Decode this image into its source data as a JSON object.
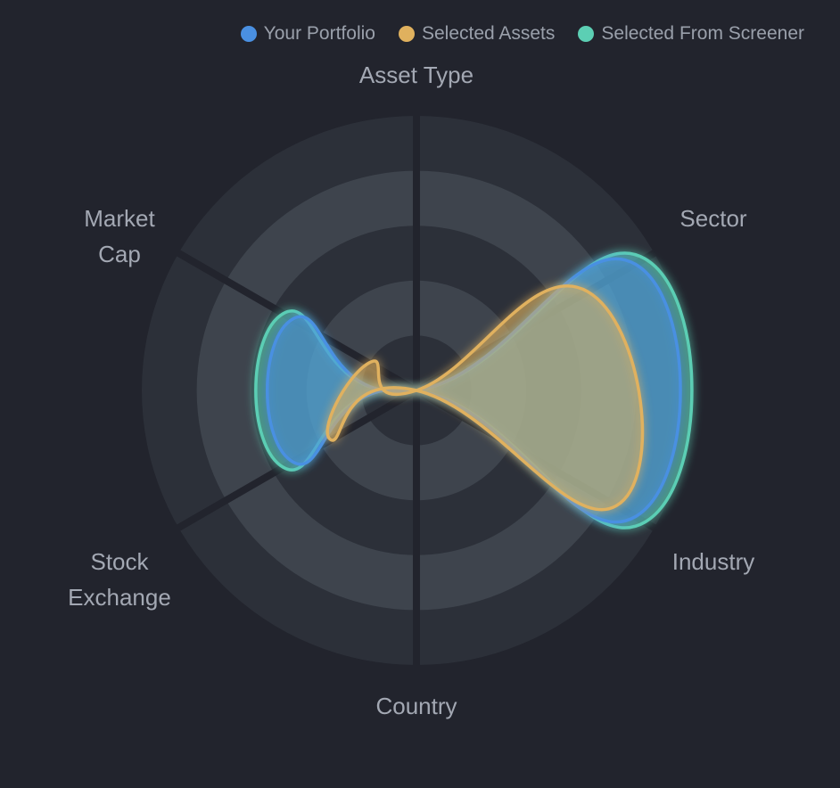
{
  "legend": {
    "items": [
      {
        "label": "Your Portfolio",
        "color": "#4a90e2"
      },
      {
        "label": "Selected Assets",
        "color": "#e0b15e"
      },
      {
        "label": "Selected From Screener",
        "color": "#5ccfb4"
      }
    ]
  },
  "axes": {
    "asset_type": "Asset Type",
    "sector": "Sector",
    "industry": "Industry",
    "country": "Country",
    "stock_exchange_line1": "Stock",
    "stock_exchange_line2": "Exchange",
    "market_cap_line1": "Market",
    "market_cap_line2": "Cap"
  },
  "chart_data": {
    "type": "radar",
    "categories": [
      "Asset Type",
      "Sector",
      "Industry",
      "Country",
      "Stock Exchange",
      "Market Cap"
    ],
    "rlim": [
      0,
      5
    ],
    "grid": true,
    "legend_position": "top-right",
    "series": [
      {
        "name": "Your Portfolio",
        "color": "#4a90e2",
        "values": [
          0,
          4.6,
          4.6,
          0,
          2.6,
          2.6
        ]
      },
      {
        "name": "Selected Assets",
        "color": "#e0b15e",
        "values": [
          0,
          3.6,
          4.2,
          0,
          1.8,
          1.0
        ]
      },
      {
        "name": "Selected From Screener",
        "color": "#5ccfb4",
        "values": [
          0,
          4.8,
          4.8,
          0,
          2.8,
          2.8
        ]
      }
    ]
  }
}
